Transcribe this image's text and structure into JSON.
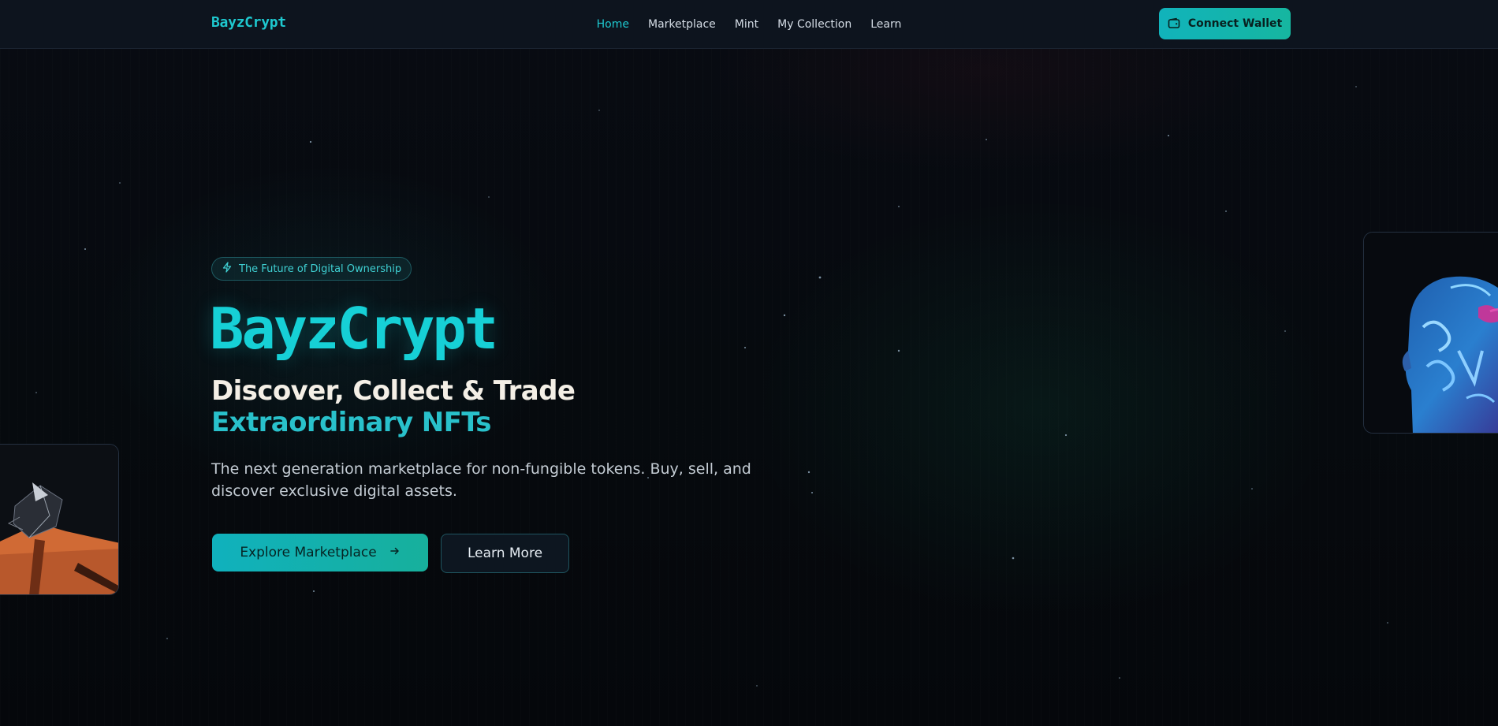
{
  "nav": {
    "logo": "BayzCrypt",
    "links": [
      {
        "label": "Home",
        "active": true
      },
      {
        "label": "Marketplace",
        "active": false
      },
      {
        "label": "Mint",
        "active": false
      },
      {
        "label": "My Collection",
        "active": false
      },
      {
        "label": "Learn",
        "active": false
      }
    ],
    "wallet_button": {
      "label": "Connect Wallet",
      "icon": "wallet-icon"
    }
  },
  "hero": {
    "badge": {
      "label": "The Future of Digital Ownership",
      "icon": "lightning-icon"
    },
    "title": "BayzCrypt",
    "subtitle_line1": "Discover, Collect & Trade",
    "subtitle_line2": "Extraordinary NFTs",
    "description": "The next generation marketplace for non-fungible tokens. Buy, sell, and discover exclusive digital assets.",
    "primary_button": {
      "label": "Explore Marketplace",
      "icon": "arrow-right-icon"
    },
    "secondary_button": {
      "label": "Learn More"
    }
  },
  "colors": {
    "accent": "#1ec8cf",
    "accent_green": "#17b09c",
    "nav_bg": "#0d141e",
    "page_bg": "#05080d",
    "subtitle_light": "#f4efe6"
  }
}
